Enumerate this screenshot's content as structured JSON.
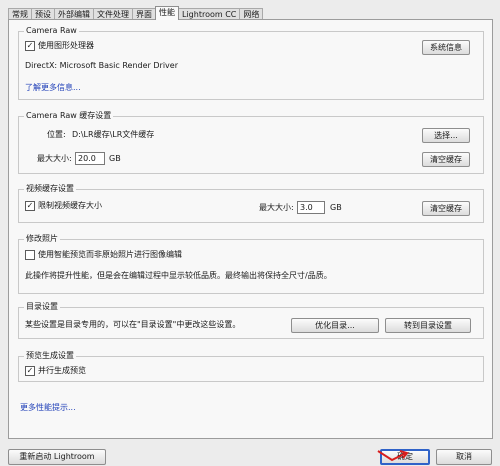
{
  "tabs": [
    "常规",
    "预设",
    "外部编辑",
    "文件处理",
    "界面",
    "性能",
    "Lightroom CC",
    "网络"
  ],
  "camera_raw": {
    "legend": "Camera Raw",
    "use_gpu_label": "使用图形处理器",
    "use_gpu_checked": true,
    "system_info_button": "系统信息",
    "driver_text": "DirectX: Microsoft Basic Render Driver",
    "more_info_link": "了解更多信息..."
  },
  "cache": {
    "legend": "Camera Raw 缓存设置",
    "location_label": "位置:",
    "location_value": "D:\\LR缓存\\LR文件缓存",
    "choose_button": "选择...",
    "max_size_label": "最大大小:",
    "max_size_value": "20.0",
    "unit": "GB",
    "purge_button": "清空缓存"
  },
  "video_cache": {
    "legend": "视频缓存设置",
    "limit_label": "限制视频缓存大小",
    "limit_checked": true,
    "max_size_label": "最大大小:",
    "max_size_value": "3.0",
    "unit": "GB",
    "purge_button": "清空缓存"
  },
  "develop": {
    "legend": "修改照片",
    "smart_preview_label": "使用智能预览而非原始照片进行图像编辑",
    "smart_preview_checked": false,
    "hint": "此操作将提升性能，但是会在编辑过程中显示较低品质。最终输出将保持全尺寸/品质。"
  },
  "catalog": {
    "legend": "目录设置",
    "description": "某些设置是目录专用的，可以在\"目录设置\"中更改这些设置。",
    "optimize_button": "优化目录...",
    "goto_button": "转到目录设置"
  },
  "preview": {
    "legend": "预览生成设置",
    "parallel_label": "并行生成预览",
    "parallel_checked": true
  },
  "more_tips_link": "更多性能提示...",
  "footer": {
    "restart_button": "重新启动 Lightroom",
    "ok_button": "确定",
    "cancel_button": "取消"
  },
  "colors": {
    "link": "#1f3fb8",
    "focus_border": "#2f62c8",
    "annotation": "#d81e1e"
  },
  "icons": {
    "checkbox_mark": "✓"
  }
}
